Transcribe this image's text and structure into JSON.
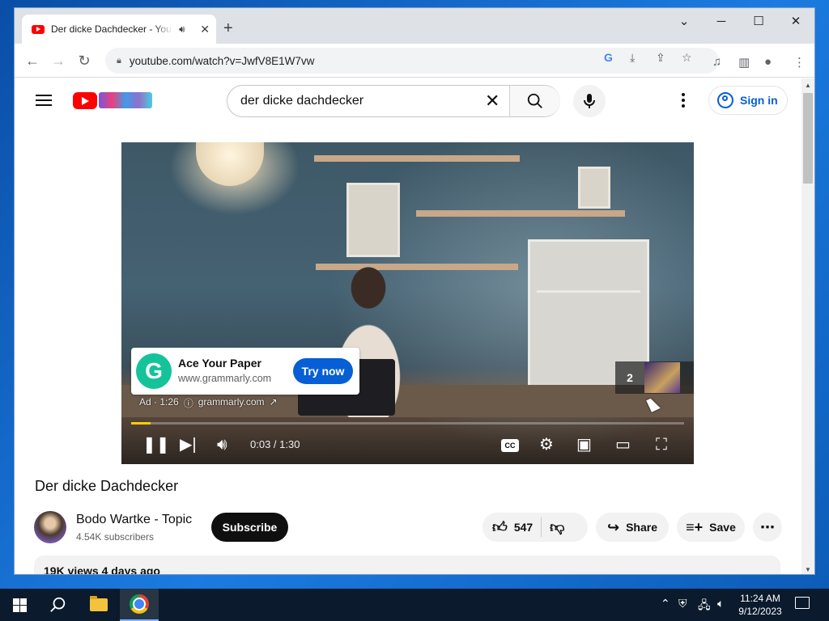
{
  "browser": {
    "tab_title": "Der dicke Dachdecker - YouTube",
    "new_tab": "+",
    "url": "youtube.com/watch?v=JwfV8E1W7vw",
    "window_controls": {
      "minimize": "─",
      "maximize": "☐",
      "close": "✕",
      "tab_list": "⌄"
    }
  },
  "youtube": {
    "search_query": "der dicke dachdecker",
    "sign_in_label": "Sign in"
  },
  "player": {
    "ad": {
      "title": "Ace Your Paper",
      "url": "www.grammarly.com",
      "cta_label": "Try now",
      "logo_letter": "G",
      "meta_ad": "Ad · 1:26",
      "meta_site": "grammarly.com"
    },
    "queue_count": "2",
    "time_display": "0:03 / 1:30",
    "progress_fraction": 0.035,
    "cc_label": "CC"
  },
  "video": {
    "title": "Der dicke Dachdecker",
    "channel_name": "Bodo Wartke - Topic",
    "subscribers": "4.54K subscribers",
    "subscribe_label": "Subscribe",
    "like_count": "547",
    "share_label": "Share",
    "save_label": "Save",
    "views_date": "19K views  4 days ago"
  },
  "taskbar": {
    "time": "11:24 AM",
    "date": "9/12/2023"
  }
}
